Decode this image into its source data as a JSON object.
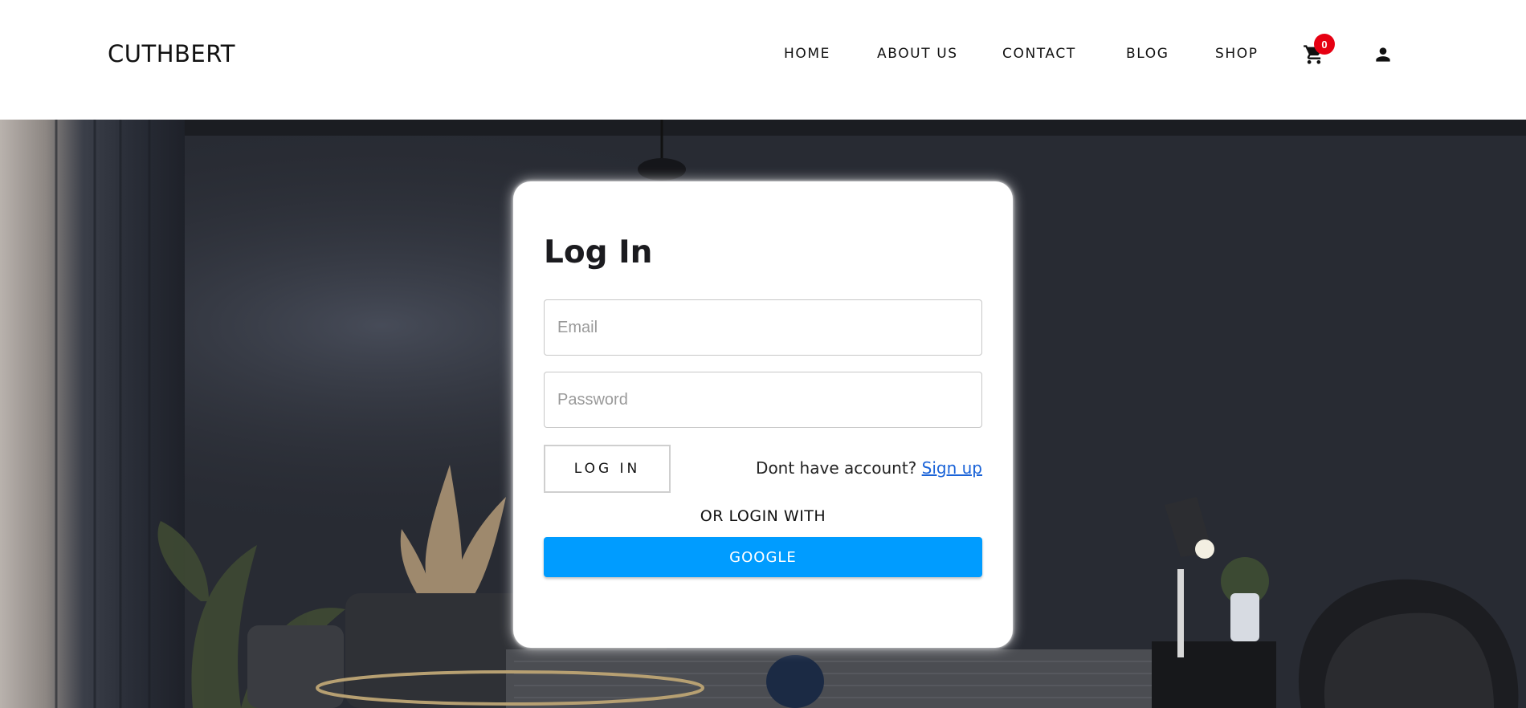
{
  "brand": {
    "name": "CUTHBERT"
  },
  "nav": {
    "items": [
      {
        "label": "HOME"
      },
      {
        "label": "ABOUT US"
      },
      {
        "label": "CONTACT"
      },
      {
        "label": "BLOG"
      },
      {
        "label": "SHOP"
      }
    ],
    "cart_icon": "cart-icon",
    "cart_count": "0",
    "user_icon": "user-icon",
    "badge_color": "#e60012"
  },
  "login": {
    "title": "Log In",
    "email_placeholder": "Email",
    "password_placeholder": "Password",
    "login_button": "LOG IN",
    "signup_prompt": "Dont have account?",
    "signup_link": "Sign up",
    "or_login_with": "OR LOGIN WITH",
    "google_button": "GOOGLE",
    "google_color": "#009cff"
  }
}
